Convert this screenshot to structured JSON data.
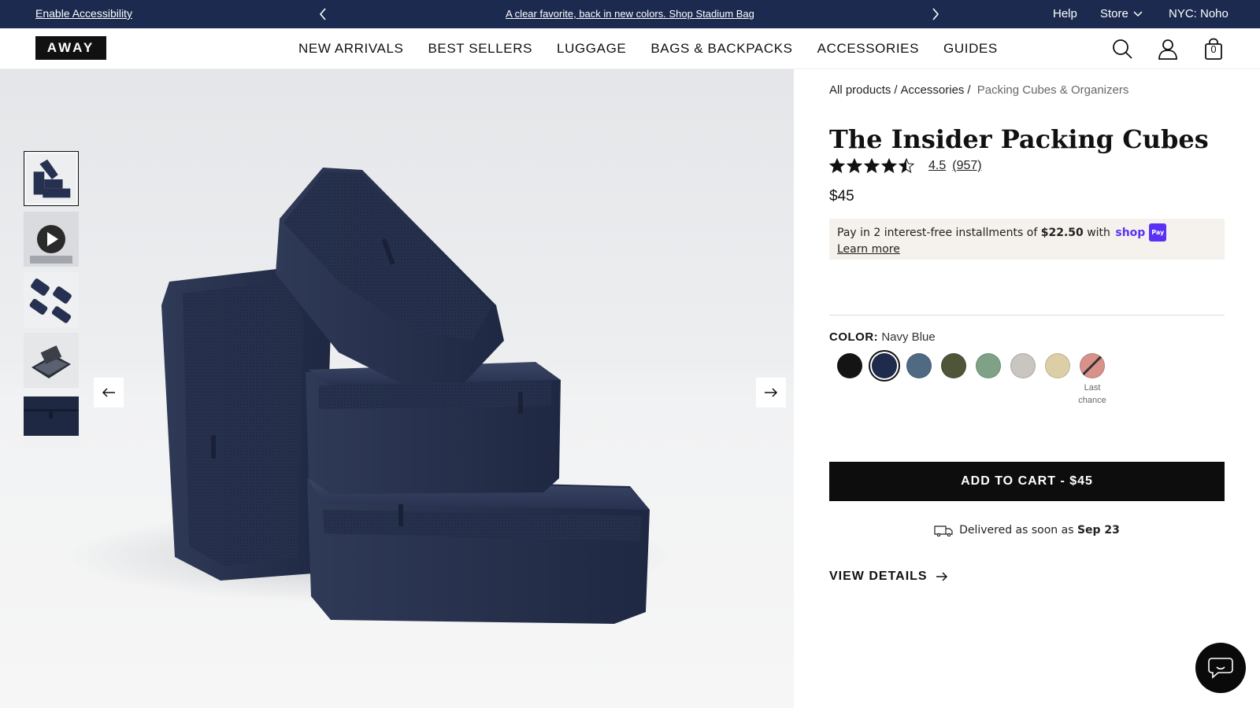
{
  "promo": {
    "accessibility": "Enable Accessibility",
    "message": "A clear favorite, back in new colors. Shop Stadium Bag",
    "help": "Help",
    "store": "Store",
    "location": "NYC: Noho"
  },
  "header": {
    "logo": "AWAY",
    "nav": [
      "NEW ARRIVALS",
      "BEST SELLERS",
      "LUGGAGE",
      "BAGS & BACKPACKS",
      "ACCESSORIES",
      "GUIDES"
    ],
    "bag_count": "0"
  },
  "breadcrumb": {
    "items": [
      "All products",
      "Accessories",
      "Packing Cubes & Organizers"
    ],
    "separator": "/"
  },
  "product": {
    "title": "The Insider Packing Cubes",
    "rating": "4.5",
    "rating_value": 4.5,
    "review_count": "(957)",
    "price": "$45",
    "installments": {
      "prefix": "Pay in 2 interest-free installments of",
      "amount": "$22.50",
      "suffix": "with",
      "brand": "shop",
      "brand_badge": "Pay",
      "learn_more": "Learn more"
    },
    "color_label": "COLOR:",
    "selected_color": "Navy Blue",
    "swatches": [
      {
        "name": "black-swatch",
        "color": "#141414",
        "note": ""
      },
      {
        "name": "navy-blue-swatch",
        "color": "#1f2b4d",
        "note": ""
      },
      {
        "name": "slate-blue-swatch",
        "color": "#4f6a82",
        "note": ""
      },
      {
        "name": "olive-swatch",
        "color": "#4e5539",
        "note": ""
      },
      {
        "name": "sage-green-swatch",
        "color": "#7fa286",
        "note": ""
      },
      {
        "name": "light-gray-swatch",
        "color": "#c9c5c1",
        "note": ""
      },
      {
        "name": "sand-swatch",
        "color": "#dccfa8",
        "note": ""
      },
      {
        "name": "rose-swatch",
        "color": "#d8928a",
        "note": "Last chance"
      }
    ],
    "add_to_cart": "ADD TO CART - $45",
    "delivery_prefix": "Delivered as soon as",
    "delivery_date": "Sep 23",
    "view_details": "VIEW DETAILS"
  },
  "colors": {
    "promo_bg": "#1b2a4e",
    "cta_bg": "#0d0d0d",
    "shoppay_bg": "#f5f1ec",
    "shoppay_brand": "#5a31f4"
  },
  "icons": {
    "promo_prev": "chevron-left-icon",
    "promo_next": "chevron-right-icon",
    "store_dropdown": "chevron-down-icon",
    "search": "search-icon",
    "account": "user-icon",
    "bag": "shopping-bag-icon",
    "gallery_prev": "arrow-left-icon",
    "gallery_next": "arrow-right-icon",
    "delivery": "truck-icon",
    "view_details": "arrow-right-icon",
    "chat": "chat-bubble-icon",
    "video_play": "play-icon"
  }
}
